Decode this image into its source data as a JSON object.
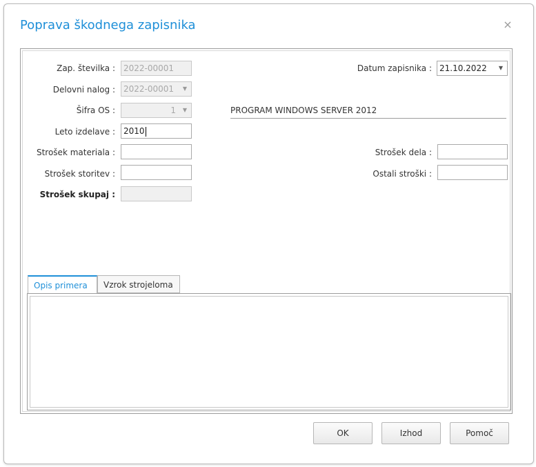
{
  "dialog": {
    "title": "Poprava škodnega zapisnika",
    "close_icon": "×"
  },
  "form": {
    "zap_stevilka": {
      "label": "Zap. številka :",
      "value": "2022-00001"
    },
    "delovni_nalog": {
      "label": "Delovni nalog :",
      "value": "2022-00001"
    },
    "sifra_os": {
      "label": "Šifra OS :",
      "value": "1",
      "description": "PROGRAM WINDOWS SERVER 2012"
    },
    "leto_izdelave": {
      "label": "Leto izdelave :",
      "value": "2010"
    },
    "strosek_materiala": {
      "label": "Strošek materiala :",
      "value": ""
    },
    "strosek_storitev": {
      "label": "Strošek storitev :",
      "value": ""
    },
    "strosek_skupaj": {
      "label": "Strošek skupaj :",
      "value": ""
    },
    "datum_zapisnika": {
      "label": "Datum zapisnika :",
      "value": "21.10.2022"
    },
    "strosek_dela": {
      "label": "Strošek dela :",
      "value": ""
    },
    "ostali_stroski": {
      "label": "Ostali stroški :",
      "value": ""
    }
  },
  "tabs": [
    {
      "label": "Opis primera",
      "active": true
    },
    {
      "label": "Vzrok strojeloma",
      "active": false
    }
  ],
  "buttons": {
    "ok": "OK",
    "izhod": "Izhod",
    "pomoc": "Pomoč"
  },
  "colors": {
    "accent": "#1e8fd8"
  }
}
